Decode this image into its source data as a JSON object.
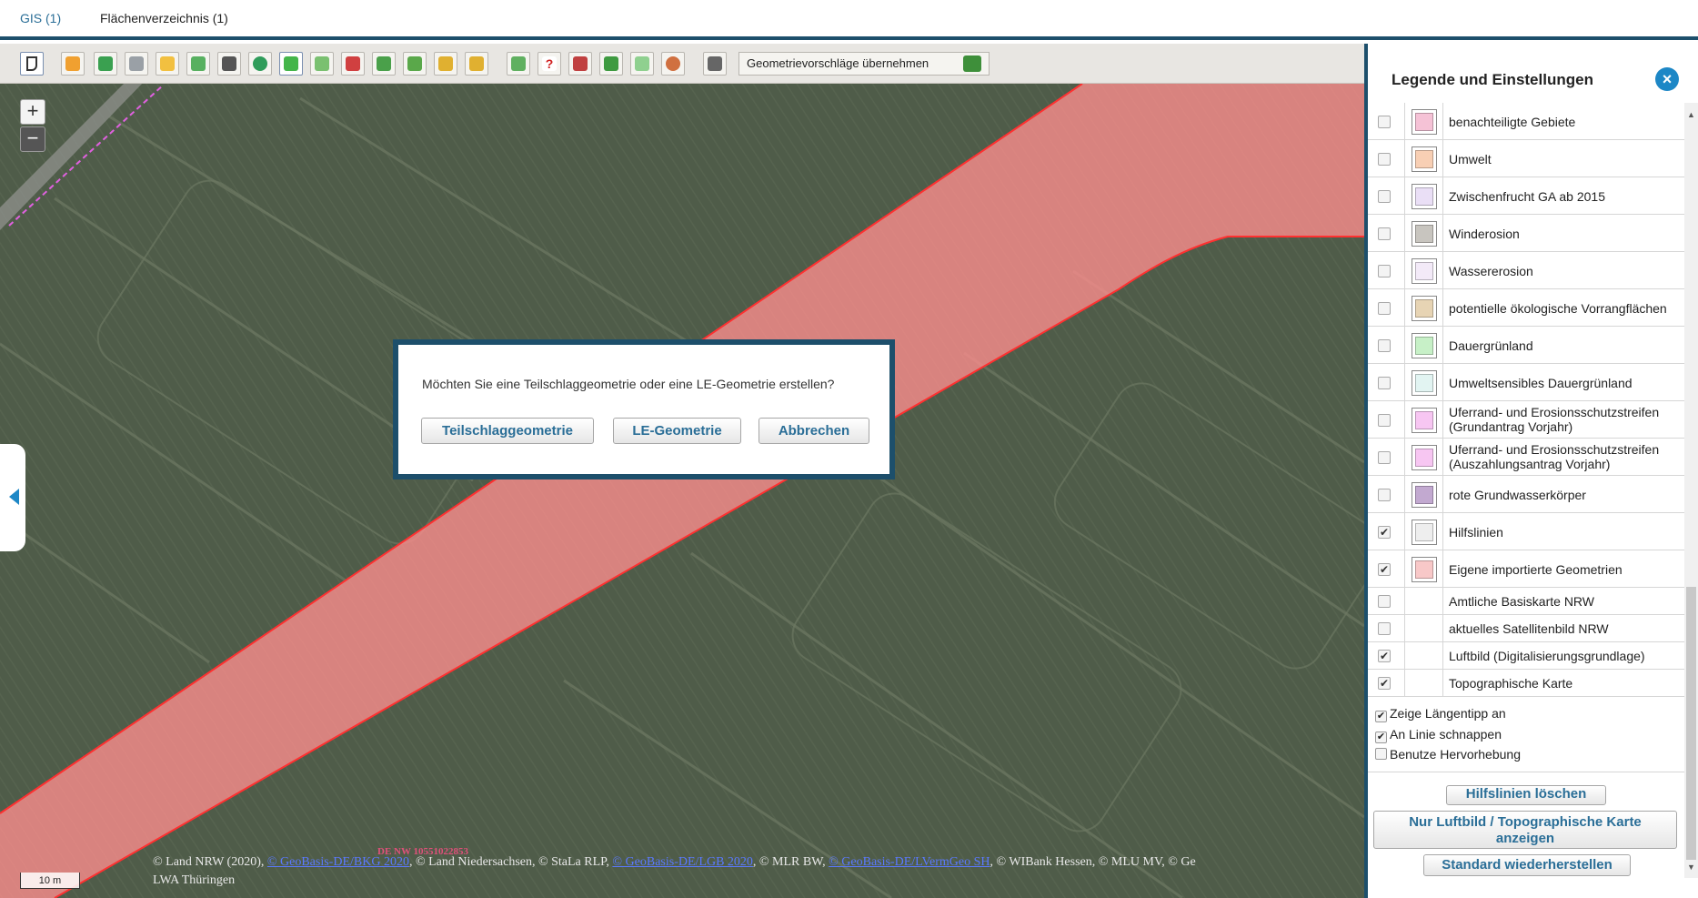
{
  "tabs": [
    {
      "label": "GIS (1)",
      "active": true
    },
    {
      "label": "Flächenverzeichnis (1)",
      "active": false
    }
  ],
  "toolbar": {
    "tools": [
      "select-arrow-icon",
      "edit-pencil-icon",
      "draw-polygon-icon",
      "cut-scissors-icon",
      "pen-icon",
      "split-icon",
      "delete-trash-icon",
      "layer-icon",
      "move-icon",
      "vertex-icon",
      "merge-icon",
      "shift-icon",
      "transform-icon",
      "reshape-icon",
      "copy-geometry-icon",
      "grid-icon",
      "help-icon",
      "import-icon",
      "export-icon",
      "buffer-icon",
      "measure-icon",
      "list-icon"
    ],
    "accept_label": "Geometrievorschläge übernehmen"
  },
  "map": {
    "zoom_in": "+",
    "zoom_out": "−",
    "scale_label": "10 m",
    "feature_label": "DE NW 10551022853",
    "attribution": {
      "p1": "© Land NRW (2020), ",
      "l1": "© GeoBasis-DE/BKG 2020",
      "p2": ", © Land Niedersachsen, © StaLa RLP, ",
      "l2": "© GeoBasis-DE/LGB 2020",
      "p3": ", © MLR BW, ",
      "l3": "© GeoBasis-DE/LVermGeo SH",
      "p4": ", © WIBank Hessen, © MLU MV, © Ge",
      "p5": "LWA Thüringen"
    }
  },
  "dialog": {
    "message": "Möchten Sie eine Teilschlaggeometrie oder eine LE-Geometrie erstellen?",
    "btn_teil": "Teilschlaggeometrie",
    "btn_le": "LE-Geometrie",
    "btn_cancel": "Abbrechen"
  },
  "panel": {
    "title": "Legende und Einstellungen",
    "close_icon": "×",
    "legend": [
      {
        "label": "benachteiligte Gebiete",
        "checked": false,
        "color": "#f5c2d6"
      },
      {
        "label": "Umwelt",
        "checked": false,
        "color": "#f8cfb4"
      },
      {
        "label": "Zwischenfrucht GA ab 2015",
        "checked": false,
        "color": "#eadff6"
      },
      {
        "label": "Winderosion",
        "checked": false,
        "color": "#c8c5bf"
      },
      {
        "label": "Wassererosion",
        "checked": false,
        "color": "#f3eaf8"
      },
      {
        "label": "potentielle ökologische Vorrangflächen",
        "checked": false,
        "color": "#e7d4b4"
      },
      {
        "label": "Dauergrünland",
        "checked": false,
        "color": "#c7f0c7"
      },
      {
        "label": "Umweltsensibles Dauergrünland",
        "checked": false,
        "color": "#e2f4f2"
      },
      {
        "label": "Uferrand- und Erosionsschutzstreifen (Grundantrag Vorjahr)",
        "label1": "Uferrand- und Erosionsschutzstreifen",
        "label2": "(Grundantrag Vorjahr)",
        "checked": false,
        "color": "#f7c6f2"
      },
      {
        "label": "Uferrand- und Erosionsschutzstreifen (Auszahlungsantrag Vorjahr)",
        "label1": "Uferrand- und Erosionsschutzstreifen",
        "label2": "(Auszahlungsantrag Vorjahr)",
        "checked": false,
        "color": "#f7c6f2"
      },
      {
        "label": "rote Grundwasserkörper",
        "checked": false,
        "color": "#c2a9d0"
      },
      {
        "label": "Hilfslinien",
        "checked": true,
        "color": "#eeeeee"
      },
      {
        "label": "Eigene importierte Geometrien",
        "checked": true,
        "color": "#f8c8c8"
      },
      {
        "label": "Amtliche Basiskarte NRW",
        "checked": false,
        "color": ""
      },
      {
        "label": "aktuelles Satellitenbild NRW",
        "checked": false,
        "color": ""
      },
      {
        "label": "Luftbild (Digitalisierungsgrundlage)",
        "checked": true,
        "color": ""
      },
      {
        "label": "Topographische Karte",
        "checked": true,
        "color": ""
      }
    ],
    "options": [
      {
        "label": "Zeige Längentipp an",
        "checked": true
      },
      {
        "label": "An Linie schnappen",
        "checked": true
      },
      {
        "label": "Benutze Hervorhebung",
        "checked": false
      }
    ],
    "btn_clear": "Hilfslinien löschen",
    "btn_only_1": "Nur Luftbild / Topographische Karte",
    "btn_only_2": "anzeigen",
    "btn_reset": "Standard wiederherstellen"
  },
  "colors": {
    "accent": "#1d4f6b",
    "link": "#2a6e97",
    "overlay": "#ff8c8c",
    "close": "#1d87c6"
  }
}
